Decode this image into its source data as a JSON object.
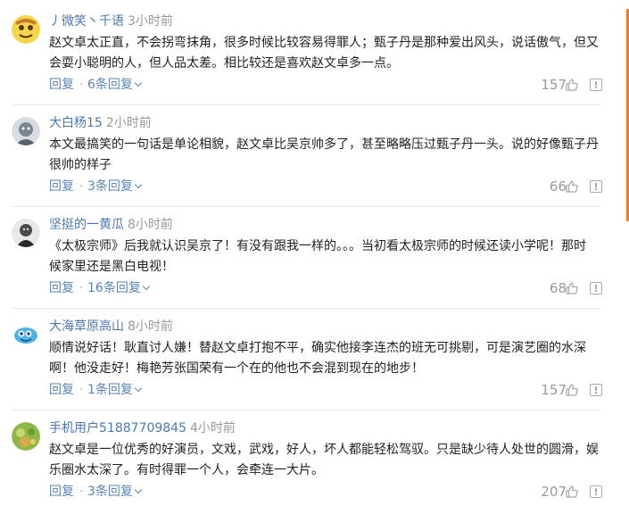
{
  "reply_label": "回复",
  "comments": [
    {
      "user": "丿微笑丶千语",
      "time": "3小时前",
      "lines": [
        "赵文卓太正直，不会拐弯抹角，很多时候比较容易得罪人；甄子丹是那种爱出风头，说话傲气，但又",
        "会耍小聪明的人，但人品太差。相比较还是喜欢赵文卓多一点。"
      ],
      "replies": "6条回复",
      "likes": "157"
    },
    {
      "user": "大白杨15",
      "time": "2小时前",
      "lines": [
        "本文最搞笑的一句话是单论相貌，赵文卓比吴京帅多了，甚至略略压过甄子丹一头。说的好像甄子丹",
        "很帅的样子"
      ],
      "replies": "3条回复",
      "likes": "66"
    },
    {
      "user": "坚挺的一黄瓜",
      "time": "8小时前",
      "lines": [
        "《太极宗师》后我就认识吴京了！有没有跟我一样的。。。当初看太极宗师的时候还读小学呢！那时",
        "候家里还是黑白电视！"
      ],
      "replies": "16条回复",
      "likes": "68"
    },
    {
      "user": "大海草原高山",
      "time": "8小时前",
      "lines": [
        "顺情说好话！耿直讨人嫌！替赵文卓打抱不平，确实他接李连杰的班无可挑剔，可是演艺圈的水深",
        "啊！他没走好！梅艳芳张国荣有一个在的他也不会混到现在的地步！"
      ],
      "replies": "1条回复",
      "likes": "157"
    },
    {
      "user": "手机用户51887709845",
      "time": "4小时前",
      "lines": [
        "赵文卓是一位优秀的好演员，文戏，武戏，好人，坏人都能轻松驾驭。只是缺少待人处世的圆滑，娱",
        "乐圈水太深了。有时得罪一个人，会牵连一大片。"
      ],
      "replies": "3条回复",
      "likes": "207"
    }
  ]
}
